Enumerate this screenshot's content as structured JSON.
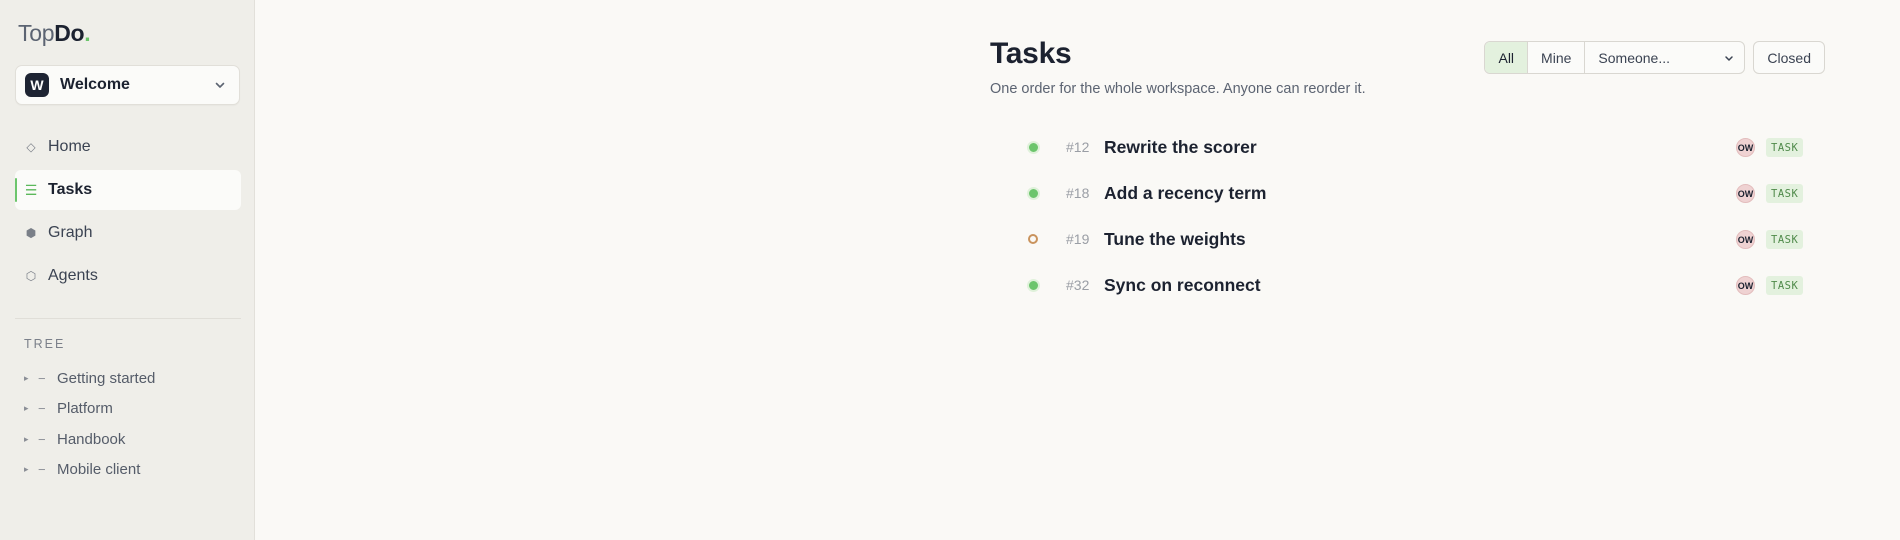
{
  "app": {
    "logo_part1": "Top",
    "logo_part2": "Do",
    "logo_dot": "."
  },
  "workspace": {
    "initial": "W",
    "name": "Welcome"
  },
  "nav": [
    {
      "label": "Home",
      "icon": "◇",
      "icon_name": "diamond-icon",
      "active": false
    },
    {
      "label": "Tasks",
      "icon": "☰",
      "icon_name": "list-icon",
      "active": true
    },
    {
      "label": "Graph",
      "icon": "⬢",
      "icon_name": "hexagon-filled-icon",
      "active": false
    },
    {
      "label": "Agents",
      "icon": "⬡",
      "icon_name": "hexagon-outline-icon",
      "active": false
    }
  ],
  "tree": {
    "heading": "TREE",
    "items": [
      {
        "label": "Getting started"
      },
      {
        "label": "Platform"
      },
      {
        "label": "Handbook"
      },
      {
        "label": "Mobile client"
      }
    ]
  },
  "page": {
    "title": "Tasks",
    "subtitle": "One order for the whole workspace. Anyone can reorder it."
  },
  "filters": {
    "all": "All",
    "mine": "Mine",
    "someone": "Someone...",
    "closed": "Closed",
    "selected": "All"
  },
  "tasks": [
    {
      "number": "#12",
      "title": "Rewrite the scorer",
      "status": "done",
      "assignee": "OW",
      "type": "TASK"
    },
    {
      "number": "#18",
      "title": "Add a recency term",
      "status": "done",
      "assignee": "OW",
      "type": "TASK"
    },
    {
      "number": "#19",
      "title": "Tune the weights",
      "status": "open",
      "assignee": "OW",
      "type": "TASK"
    },
    {
      "number": "#32",
      "title": "Sync on reconnect",
      "status": "done",
      "assignee": "OW",
      "type": "TASK"
    }
  ],
  "colors": {
    "accent_green": "#6cc56c",
    "open_status": "#c9935d",
    "badge_bg": "#e3f1de",
    "badge_text": "#4f8a4a",
    "avatar_bg": "#efd2d2",
    "sidebar_bg": "#efeee9",
    "page_bg": "#faf9f6"
  }
}
